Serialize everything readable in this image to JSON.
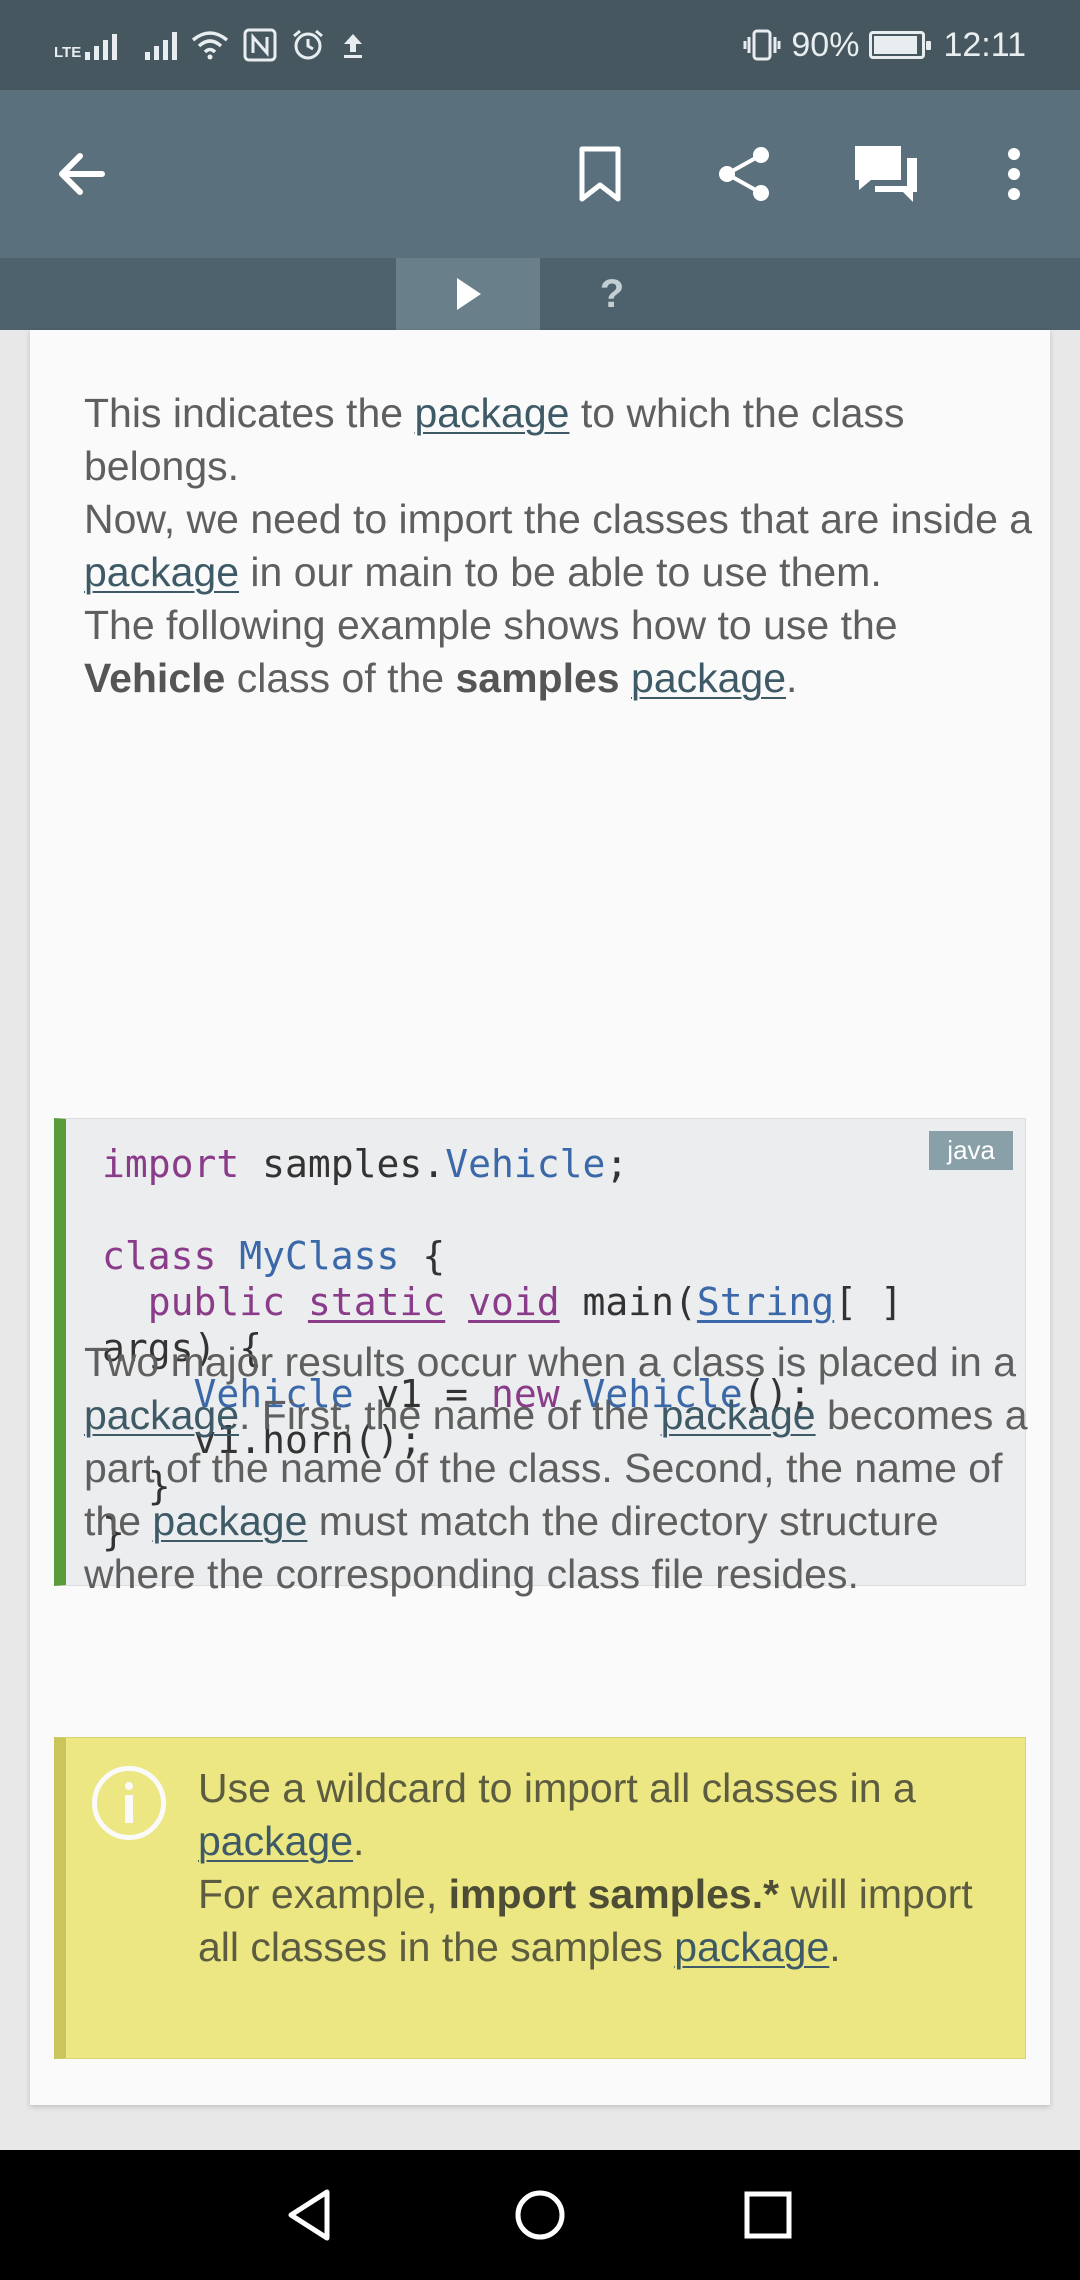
{
  "status_bar": {
    "network_label": "LTE",
    "battery": "90%",
    "time": "12:11",
    "icons": [
      "signal-icon",
      "wifi-icon",
      "nfc-icon",
      "alarm-icon",
      "upload-icon",
      "vibrate-icon",
      "battery-icon"
    ]
  },
  "app_bar": {
    "icons": [
      "back-arrow-icon",
      "bookmark-icon",
      "share-icon",
      "comments-icon",
      "more-vert-icon"
    ]
  },
  "tabs": [
    {
      "icon": "play-icon",
      "active": true
    },
    {
      "label": "?",
      "active": false
    }
  ],
  "content": {
    "para1": {
      "p1": "This indicates the ",
      "link1": "package",
      "p2": " to which the class belongs.",
      "p3": "Now, we need to import the classes that are inside a ",
      "link2": "package",
      "p4": " in our main to be able to use them.",
      "p5": "The following example shows how to use the ",
      "bold1": "Vehicle",
      "p6": " class of the ",
      "bold2": "samples",
      "p7": " ",
      "link3": "package",
      "p8": "."
    },
    "code_block": {
      "language": "java",
      "lines": [
        [
          {
            "t": "import",
            "c": "kw"
          },
          {
            "t": " samples."
          },
          {
            "t": "Vehicle",
            "c": "ty"
          },
          {
            "t": ";"
          }
        ],
        [],
        [
          {
            "t": "class",
            "c": "kw"
          },
          {
            "t": " "
          },
          {
            "t": "MyClass",
            "c": "ty"
          },
          {
            "t": " {"
          }
        ],
        [
          {
            "t": "  "
          },
          {
            "t": "public",
            "c": "kw"
          },
          {
            "t": " "
          },
          {
            "t": "static",
            "c": "kw ul"
          },
          {
            "t": " "
          },
          {
            "t": "void",
            "c": "kw ul"
          },
          {
            "t": " main("
          },
          {
            "t": "String",
            "c": "ty ul"
          },
          {
            "t": "[ ]"
          }
        ],
        [
          {
            "t": "args) {"
          }
        ],
        [
          {
            "t": "    "
          },
          {
            "t": "Vehicle",
            "c": "ty"
          },
          {
            "t": " v1 = "
          },
          {
            "t": "new",
            "c": "kw"
          },
          {
            "t": " "
          },
          {
            "t": "Vehicle",
            "c": "ty"
          },
          {
            "t": "();"
          }
        ],
        [
          {
            "t": "    v1.horn();"
          }
        ],
        [
          {
            "t": "  }"
          }
        ],
        [
          {
            "t": "}"
          }
        ]
      ]
    },
    "para2": {
      "p1": "Two major results occur when a class is placed in a ",
      "link1": "package",
      "p2": ". First, the name of the ",
      "link2": "package",
      "p3": " becomes a part of the name of the class. Second, the name of the ",
      "link3": "package",
      "p4": " must match the directory structure where the corresponding class file resides."
    },
    "note": {
      "icon": "info-icon",
      "p1": "Use a wildcard to import all classes in a ",
      "link1": "package",
      "p2": ".",
      "p3": "For example, ",
      "bold1": "import samples.*",
      "p4": " will import all classes in the samples ",
      "link2": "package",
      "p5": "."
    }
  },
  "nav_bar": {
    "icons": [
      "back-triangle-icon",
      "home-circle-icon",
      "recents-square-icon"
    ]
  }
}
